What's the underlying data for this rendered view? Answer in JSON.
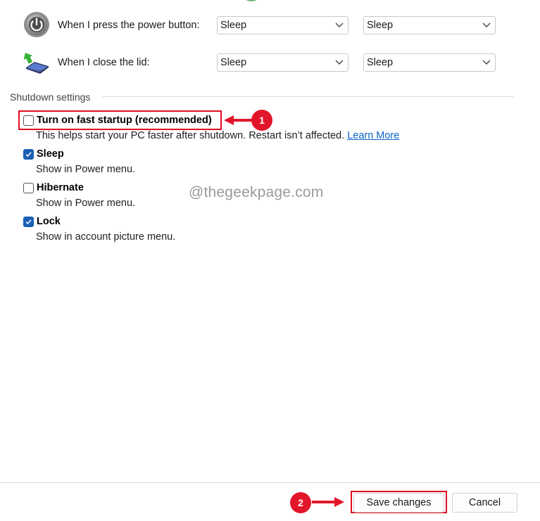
{
  "power_rows": [
    {
      "label": "When I press the power button:",
      "on_battery_value": "Sleep",
      "plugged_in_value": "Sleep",
      "icon": "power-button-icon"
    },
    {
      "label": "When I close the lid:",
      "on_battery_value": "Sleep",
      "plugged_in_value": "Sleep",
      "icon": "laptop-lid-icon"
    }
  ],
  "shutdown": {
    "section_label": "Shutdown settings",
    "options": [
      {
        "title": "Turn on fast startup (recommended)",
        "description": "This helps start your PC faster after shutdown. Restart isn’t affected.",
        "link": "Learn More",
        "checked": false
      },
      {
        "title": "Sleep",
        "description": "Show in Power menu.",
        "checked": true
      },
      {
        "title": "Hibernate",
        "description": "Show in Power menu.",
        "checked": false
      },
      {
        "title": "Lock",
        "description": "Show in account picture menu.",
        "checked": true
      }
    ]
  },
  "watermark": "@thegeekpage.com",
  "annotations": {
    "step1": "1",
    "step2": "2",
    "color": "#e2162a"
  },
  "footer": {
    "save_label": "Save changes",
    "cancel_label": "Cancel"
  },
  "colors": {
    "accent": "#1a5fb4",
    "link": "#0a63c9",
    "highlight": "#e01020"
  }
}
